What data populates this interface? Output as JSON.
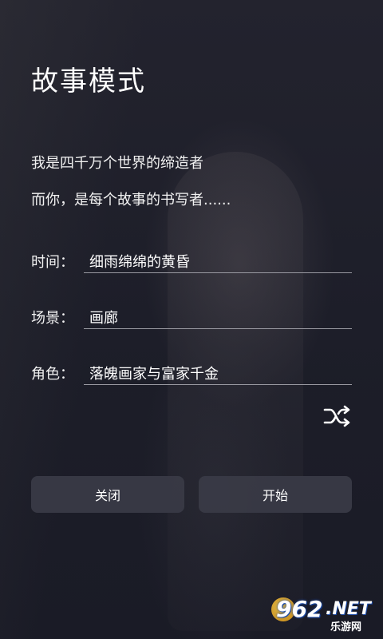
{
  "title": "故事模式",
  "intro": {
    "line1": "我是四千万个世界的缔造者",
    "line2": "而你，是每个故事的书写者......"
  },
  "fields": [
    {
      "label": "时间：",
      "value": "细雨绵绵的黄昏"
    },
    {
      "label": "场景：",
      "value": "画廊"
    },
    {
      "label": "角色：",
      "value": "落魄画家与富家千金"
    }
  ],
  "shuffle_icon": "shuffle-icon",
  "buttons": {
    "close_label": "关闭",
    "start_label": "开始"
  },
  "watermark": {
    "number": "962",
    "suffix": ".NET",
    "subtitle": "乐游网"
  },
  "colors": {
    "background": "#1b1c27",
    "button_bg": "#3a3b46",
    "underline": "#9a9aa2",
    "text": "#ffffff"
  }
}
